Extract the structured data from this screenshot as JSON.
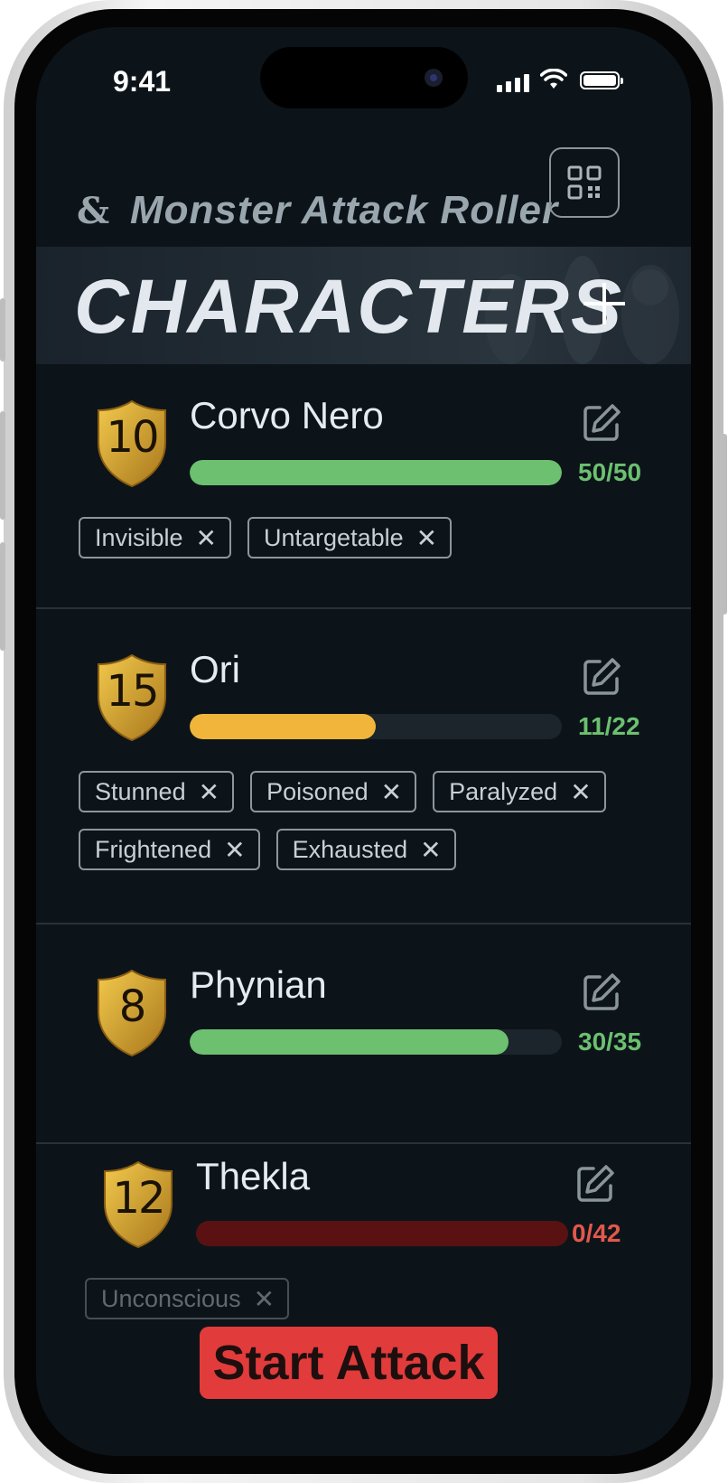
{
  "status_bar": {
    "time": "9:41"
  },
  "header": {
    "logo": "&",
    "title": "Monster Attack Roller",
    "qr_icon": "qr-code-icon"
  },
  "banner": {
    "title": "CHARACTERS",
    "add_icon": "plus-icon"
  },
  "characters": [
    {
      "level": "10",
      "name": "Corvo Nero",
      "hp_text": "50/50",
      "hp_fraction": 1.0,
      "bar_color": "#6cc06f",
      "text_color": "#6cc06f",
      "conditions": [
        "Invisible",
        "Untargetable"
      ]
    },
    {
      "level": "15",
      "name": "Ori",
      "hp_text": "11/22",
      "hp_fraction": 0.5,
      "bar_color": "#f0b53a",
      "text_color": "#6cc06f",
      "conditions": [
        "Stunned",
        "Poisoned",
        "Paralyzed",
        "Frightened",
        "Exhausted"
      ]
    },
    {
      "level": "8",
      "name": "Phynian",
      "hp_text": "30/35",
      "hp_fraction": 0.857,
      "bar_color": "#6cc06f",
      "text_color": "#6cc06f",
      "conditions": []
    },
    {
      "level": "12",
      "name": "Thekla",
      "hp_text": "0/42",
      "hp_fraction": 0.0,
      "bar_color": "#5a1111",
      "text_color": "#e3584a",
      "conditions": [
        "Unconscious"
      ]
    }
  ],
  "remove_glyph": "✕",
  "start_button": {
    "label": "Start Attack",
    "color": "#e23b3b"
  }
}
